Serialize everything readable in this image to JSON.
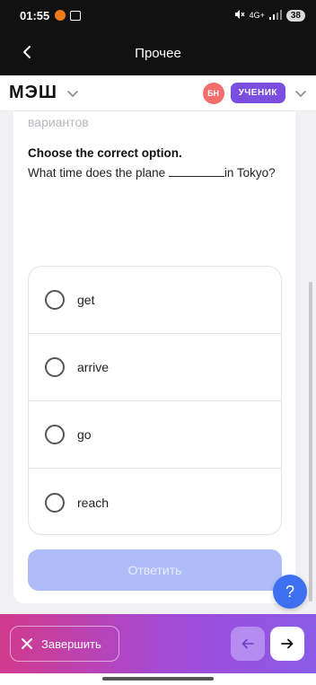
{
  "status_bar": {
    "time": "01:55",
    "network": "4G+",
    "battery": "38"
  },
  "header": {
    "title": "Прочее"
  },
  "app_bar": {
    "logo": "МЭШ",
    "avatar_initials": "БН",
    "role": "УЧЕНИК"
  },
  "task": {
    "faded_text": "вариантов",
    "instruction": "Choose the correct option.",
    "question_before": "What time does the plane ",
    "question_after": "in Tokyo?",
    "options": [
      {
        "label": "get"
      },
      {
        "label": "arrive"
      },
      {
        "label": "go"
      },
      {
        "label": "reach"
      }
    ],
    "submit_label": "Ответить"
  },
  "help": {
    "label": "?"
  },
  "bottom_bar": {
    "finish_label": "Завершить"
  },
  "colors": {
    "accent": "#3e6ff0",
    "role_badge": "#7a4fe0",
    "submit_disabled": "#aebcf8"
  }
}
